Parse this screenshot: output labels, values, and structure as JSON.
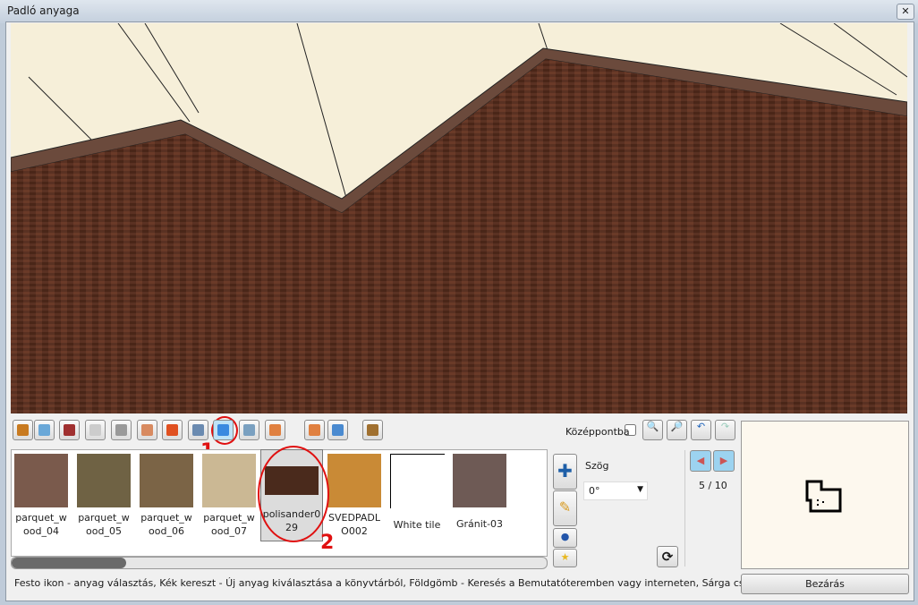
{
  "window": {
    "title": "Padló anyaga",
    "close_icon": "close-icon"
  },
  "toolbar": {
    "icons": [
      "door-icon",
      "window-icon",
      "wall-color-icon",
      "wardrobe-icon",
      "shelf-icon",
      "ceiling-lamp-icon",
      "wall-lamp-icon",
      "picture-icon",
      "floor-icon",
      "floor-alt-icon",
      "room-walls-icon",
      "tile-walls-icon",
      "tile-floor-icon",
      "furniture-icon"
    ],
    "selected": "floor-icon",
    "center_label": "Középpontba",
    "center_checked": false
  },
  "annotations": {
    "one": "1",
    "two": "2"
  },
  "materials": [
    {
      "label": "parquet_wood_04",
      "line1": "parquet_w",
      "line2": "ood_04",
      "color": "#7a5a4c"
    },
    {
      "label": "parquet_wood_05",
      "line1": "parquet_w",
      "line2": "ood_05",
      "color": "#6f6244"
    },
    {
      "label": "parquet_wood_06",
      "line1": "parquet_w",
      "line2": "ood_06",
      "color": "#7b6446"
    },
    {
      "label": "parquet_wood_07",
      "line1": "parquet_w",
      "line2": "ood_07",
      "color": "#cbb894"
    },
    {
      "label": "polisander029",
      "line1": "polisander0",
      "line2": "29",
      "color": "#4a2a1c",
      "selected": true
    },
    {
      "label": "SVEDPADLO002",
      "line1": "SVEDPADL",
      "line2": "O002",
      "color": "#c98a36"
    },
    {
      "label": "White tile",
      "line1": "White tile",
      "line2": "",
      "color": "#ffffff"
    },
    {
      "label": "Gránit-03",
      "line1": "Gránit-03",
      "line2": "",
      "color": "#6e5a55"
    }
  ],
  "angle": {
    "label": "Szög",
    "value": "0°"
  },
  "pager": {
    "text": "5 / 10"
  },
  "status": "Festo ikon - anyag választás, Kék kereszt - Új anyag kiválasztása a könyvtárból, Földgömb - Keresés a Bemutatóteremben vagy interneten, Sárga csillag - új anyag",
  "close_button": "Bezárás",
  "colors": {
    "floor": "#5a3122",
    "wall": "#f6efd9",
    "baseboard": "#6b4a3c",
    "accent": "#e01010"
  }
}
